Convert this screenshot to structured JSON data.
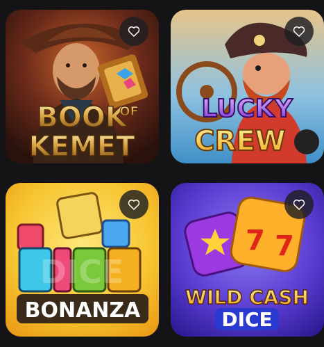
{
  "games": [
    {
      "title_line1": "BOOK",
      "title_line2": "OF",
      "title_line3": "KEMET",
      "favorite_icon": "heart-outline-icon"
    },
    {
      "title_line1": "LUCKY",
      "title_line2": "CREW",
      "favorite_icon": "heart-outline-icon"
    },
    {
      "title_line1": "DICE",
      "title_line2": "BONANZA",
      "favorite_icon": "heart-outline-icon"
    },
    {
      "title_line1": "WILD CASH",
      "title_line2": "DICE",
      "favorite_icon": "heart-outline-icon"
    }
  ],
  "colors": {
    "page_background": "#141416",
    "favorite_button_background": "#1e1e22",
    "heart_stroke": "#ffffff"
  }
}
